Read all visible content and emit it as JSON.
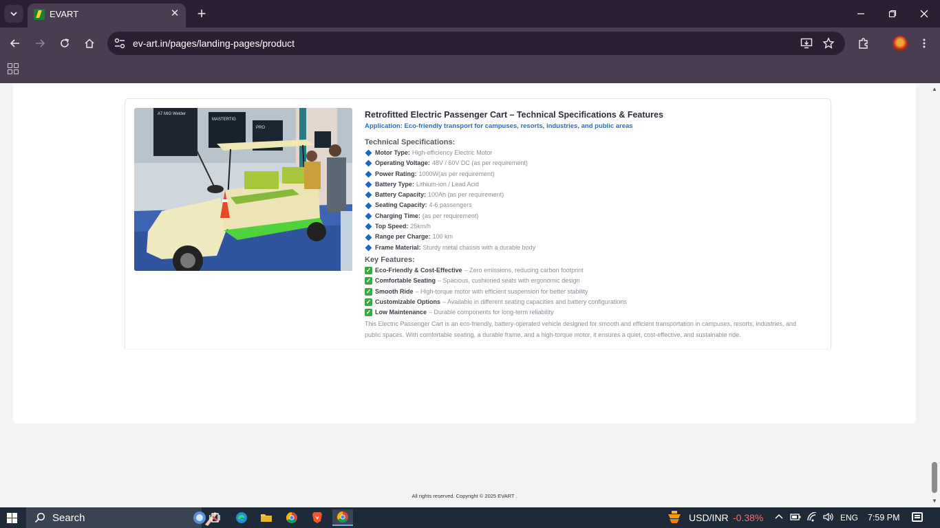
{
  "browser": {
    "tab_title": "EVART",
    "tab_close": "✕",
    "new_tab": "+",
    "url": "ev-art.in/pages/landing-pages/product"
  },
  "product": {
    "title": "Retrofitted Electric Passenger Cart – Technical Specifications & Features",
    "application": "Application: Eco-friendly transport for campuses, resorts, industries, and public areas",
    "tech_heading": "Technical Specifications:",
    "specs": [
      {
        "label": "Motor Type:",
        "value": "High-efficiency Electric Motor"
      },
      {
        "label": "Operating Voltage:",
        "value": "48V / 60V DC (as per requirement)"
      },
      {
        "label": "Power Rating:",
        "value": "1000W(as per requirement)"
      },
      {
        "label": "Battery Type:",
        "value": "Lithium-ion / Lead Acid"
      },
      {
        "label": "Battery Capacity:",
        "value": "100Ah (as per requirement)"
      },
      {
        "label": "Seating Capacity:",
        "value": "4-6 passengers"
      },
      {
        "label": "Charging Time:",
        "value": "(as per requirement)"
      },
      {
        "label": "Top Speed:",
        "value": "25km/h"
      },
      {
        "label": "Range per Charge:",
        "value": "100 km"
      },
      {
        "label": "Frame Material:",
        "value": "Sturdy metal chassis with a durable body"
      }
    ],
    "features_heading": "Key Features:",
    "features": [
      {
        "label": "Eco-Friendly & Cost-Effective",
        "value": "– Zero emissions, reducing carbon footprint"
      },
      {
        "label": "Comfortable Seating",
        "value": "– Spacious, cushioned seats with ergonomic design"
      },
      {
        "label": "Smooth Ride",
        "value": "– High-torque motor with efficient suspension for better stability"
      },
      {
        "label": "Customizable Options",
        "value": "– Available in different seating capacities and battery configurations"
      },
      {
        "label": "Low Maintenance",
        "value": "– Durable components for long-term reliability"
      }
    ],
    "description": "This Electric Passenger Cart is an eco-friendly, battery-operated vehicle designed for smooth and efficient transportation in campuses, resorts, industries, and public spaces. With comfortable seating, a durable frame, and a high-torque motor, it ensures a quiet, cost-effective, and sustainable ride.",
    "image_posters": [
      "A7 MIG Welder",
      "MASTERTIG",
      "PRO"
    ]
  },
  "footer": {
    "copyright": "All rights reserved. Copyright © 2025 EVART ."
  },
  "taskbar": {
    "search_label": "Search",
    "ticker_name": "USD/INR",
    "ticker_value": "-0.38%",
    "language": "ENG",
    "time": "7:59 PM"
  },
  "colors": {
    "chrome_dark": "#2b1f33",
    "chrome_mid": "#4a3d52",
    "accent_blue": "#1f6fd6",
    "check_green": "#3aa845",
    "ticker_negative": "#ff6b6b"
  }
}
